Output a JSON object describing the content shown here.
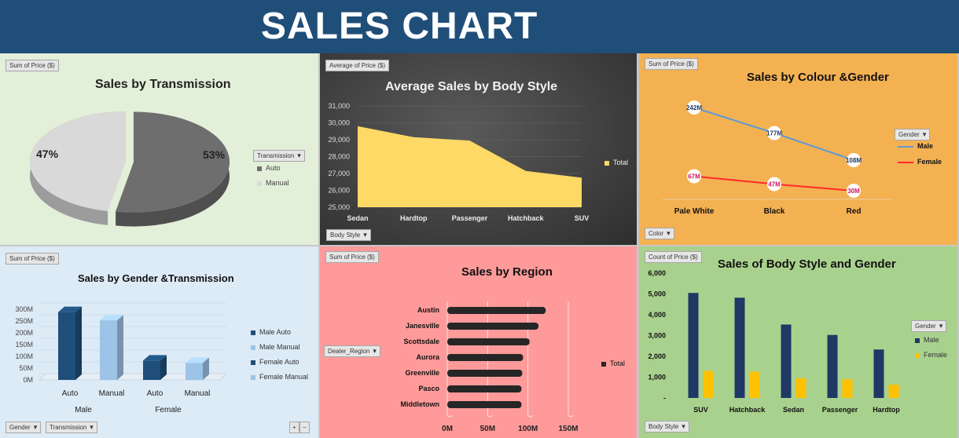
{
  "header": {
    "title": "SALES CHART"
  },
  "panels": {
    "p1": {
      "button": "Sum of Price ($)",
      "filter": "Transmission",
      "bg": "#e2efd9"
    },
    "p2": {
      "button": "Average of Price ($)",
      "filter": "Body Style",
      "bg": "#3b3b3b"
    },
    "p3": {
      "button": "Sum of Price ($)",
      "legend_button": "Gender",
      "filter": "Color",
      "bg": "#f4b152"
    },
    "p4": {
      "button": "Sum of Price ($)",
      "filter1": "Gender",
      "filter2": "Transmission",
      "plus": "+",
      "minus": "−",
      "bg": "#ddebf7"
    },
    "p5": {
      "button": "Sum of Price ($)",
      "filter": "Dealer_Region",
      "bg": "#ff9a9a"
    },
    "p6": {
      "button": "Count of Price ($)",
      "legend_button": "Gender",
      "filter": "Body Style",
      "bg": "#a9d18e"
    }
  },
  "chart_data": [
    {
      "type": "pie",
      "title": "Sales by Transmission",
      "categories": [
        "Auto",
        "Manual"
      ],
      "values": [
        53,
        47
      ],
      "labels": [
        "53%",
        "47%"
      ],
      "colors": [
        "#6e6e6e",
        "#d9d9d9"
      ],
      "legend": "right"
    },
    {
      "type": "area",
      "title": "Average Sales by Body Style",
      "categories": [
        "Sedan",
        "Hardtop",
        "Passenger",
        "Hatchback",
        "SUV"
      ],
      "series": [
        {
          "name": "Total",
          "values": [
            29800,
            29150,
            28950,
            27150,
            26750
          ],
          "color": "#ffd966"
        }
      ],
      "ylim": [
        25000,
        31000
      ],
      "yticks": [
        "25,000",
        "26,000",
        "27,000",
        "28,000",
        "29,000",
        "30,000",
        "31,000"
      ],
      "grid": true,
      "legend": "right"
    },
    {
      "type": "line",
      "title": "Sales by Colour &Gender",
      "categories": [
        "Pale White",
        "Black",
        "Red"
      ],
      "series": [
        {
          "name": "Male",
          "values": [
            242,
            177,
            108
          ],
          "labels": [
            "242M",
            "177M",
            "108M"
          ],
          "color": "#5b9bd5"
        },
        {
          "name": "Female",
          "values": [
            67,
            47,
            30
          ],
          "labels": [
            "67M",
            "47M",
            "30M"
          ],
          "color": "#ff2a2a"
        }
      ],
      "ylim": [
        0,
        260
      ],
      "legend": "right"
    },
    {
      "type": "bar",
      "title": "Sales by Gender &Transmission",
      "groups": [
        "Male",
        "Female"
      ],
      "categories": [
        "Auto",
        "Manual",
        "Auto",
        "Manual"
      ],
      "series": [
        {
          "name": "Male Auto",
          "values": [
            288
          ],
          "color": "#1f4e79"
        },
        {
          "name": "Male Manual",
          "values": [
            253
          ],
          "color": "#9dc3e6"
        },
        {
          "name": "Female Auto",
          "values": [
            82
          ],
          "color": "#1f4e79"
        },
        {
          "name": "Female Manual",
          "values": [
            72
          ],
          "color": "#9dc3e6"
        }
      ],
      "values": [
        288,
        253,
        82,
        72
      ],
      "ylim": [
        0,
        300
      ],
      "yticks": [
        "0M",
        "50M",
        "100M",
        "150M",
        "200M",
        "250M",
        "300M"
      ],
      "grid": true,
      "legend": "right"
    },
    {
      "type": "bar",
      "orientation": "horizontal",
      "title": "Sales by Region",
      "categories": [
        "Austin",
        "Janesville",
        "Scottsdale",
        "Aurora",
        "Greenville",
        "Pasco",
        "Middletown"
      ],
      "series": [
        {
          "name": "Total",
          "values": [
            122,
            113,
            102,
            94,
            93,
            92,
            92
          ],
          "color": "#262626"
        }
      ],
      "xlim": [
        0,
        150
      ],
      "xticks": [
        "0M",
        "50M",
        "100M",
        "150M"
      ],
      "grid": true,
      "legend": "right"
    },
    {
      "type": "bar",
      "title": "Sales of Body Style and Gender",
      "categories": [
        "SUV",
        "Hatchback",
        "Sedan",
        "Passenger",
        "Hardtop"
      ],
      "series": [
        {
          "name": "Male",
          "values": [
            5050,
            4820,
            3530,
            3030,
            2330
          ],
          "color": "#1f3864"
        },
        {
          "name": "Female",
          "values": [
            1300,
            1270,
            950,
            900,
            640
          ],
          "color": "#ffc000"
        }
      ],
      "ylim": [
        0,
        6000
      ],
      "yticks": [
        "-",
        "1,000",
        "2,000",
        "3,000",
        "4,000",
        "5,000",
        "6,000"
      ],
      "legend": "right"
    }
  ]
}
